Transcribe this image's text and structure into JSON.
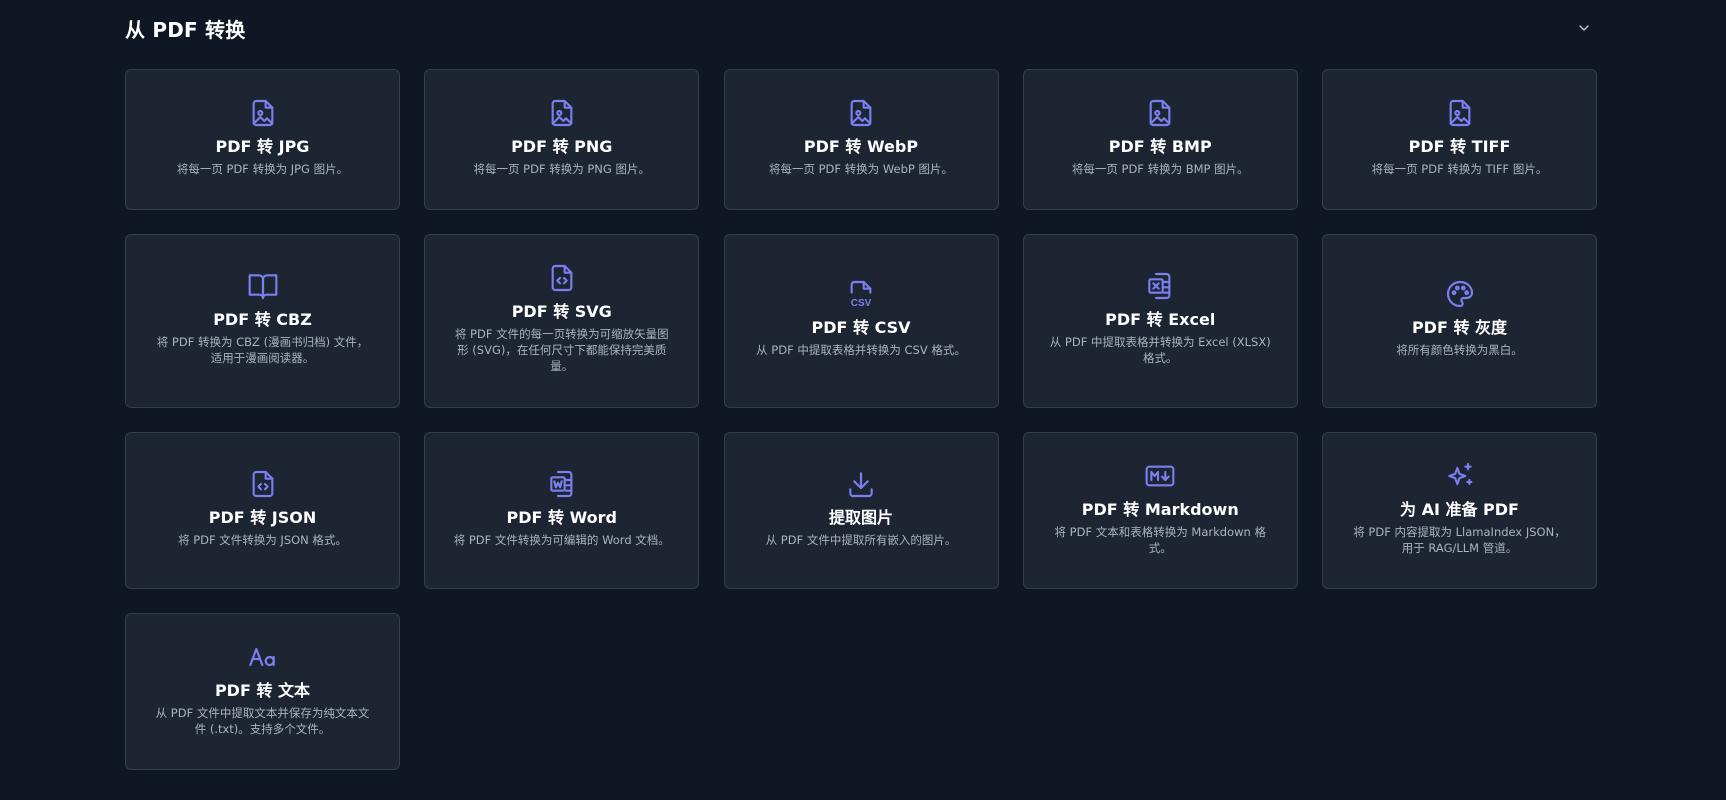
{
  "section": {
    "title": "从 PDF 转换",
    "collapse_icon": "chevron-down-icon"
  },
  "colors": {
    "background": "#0f1624",
    "card_background": "#1d2533",
    "card_border": "#343d4d",
    "icon_accent": "#7b7ff0",
    "description_text": "#aab3c2"
  },
  "cards": [
    {
      "id": "jpg",
      "icon": "image-file-icon",
      "title": "PDF 转 JPG",
      "description": "将每一页 PDF 转换为 JPG 图片。"
    },
    {
      "id": "png",
      "icon": "image-file-icon",
      "title": "PDF 转 PNG",
      "description": "将每一页 PDF 转换为 PNG 图片。"
    },
    {
      "id": "webp",
      "icon": "image-file-icon",
      "title": "PDF 转 WebP",
      "description": "将每一页 PDF 转换为 WebP 图片。"
    },
    {
      "id": "bmp",
      "icon": "image-file-icon",
      "title": "PDF 转 BMP",
      "description": "将每一页 PDF 转换为 BMP 图片。"
    },
    {
      "id": "tiff",
      "icon": "image-file-icon",
      "title": "PDF 转 TIFF",
      "description": "将每一页 PDF 转换为 TIFF 图片。"
    },
    {
      "id": "cbz",
      "icon": "open-book-icon",
      "title": "PDF 转 CBZ",
      "description": "将 PDF 转换为 CBZ (漫画书归档) 文件，适用于漫画阅读器。"
    },
    {
      "id": "svg",
      "icon": "code-file-icon",
      "title": "PDF 转 SVG",
      "description": "将 PDF 文件的每一页转换为可缩放矢量图形 (SVG)，在任何尺寸下都能保持完美质量。"
    },
    {
      "id": "csv",
      "icon": "csv-file-icon",
      "title": "PDF 转 CSV",
      "description": "从 PDF 中提取表格并转换为 CSV 格式。"
    },
    {
      "id": "excel",
      "icon": "excel-file-icon",
      "title": "PDF 转 Excel",
      "description": "从 PDF 中提取表格并转换为 Excel (XLSX) 格式。"
    },
    {
      "id": "grayscale",
      "icon": "palette-icon",
      "title": "PDF 转 灰度",
      "description": "将所有颜色转换为黑白。"
    },
    {
      "id": "json",
      "icon": "code-file-icon",
      "title": "PDF 转 JSON",
      "description": "将 PDF 文件转换为 JSON 格式。"
    },
    {
      "id": "word",
      "icon": "word-file-icon",
      "title": "PDF 转 Word",
      "description": "将 PDF 文件转换为可编辑的 Word 文档。"
    },
    {
      "id": "extract-images",
      "icon": "download-icon",
      "title": "提取图片",
      "description": "从 PDF 文件中提取所有嵌入的图片。"
    },
    {
      "id": "markdown",
      "icon": "markdown-icon",
      "title": "PDF 转 Markdown",
      "description": "将 PDF 文本和表格转换为 Markdown 格式。"
    },
    {
      "id": "ai",
      "icon": "sparkles-icon",
      "title": "为 AI 准备 PDF",
      "description": "将 PDF 内容提取为 LlamaIndex JSON，用于 RAG/LLM 管道。"
    },
    {
      "id": "text",
      "icon": "text-aa-icon",
      "title": "PDF 转 文本",
      "description": "从 PDF 文件中提取文本并保存为纯文本文件 (.txt)。支持多个文件。"
    }
  ]
}
